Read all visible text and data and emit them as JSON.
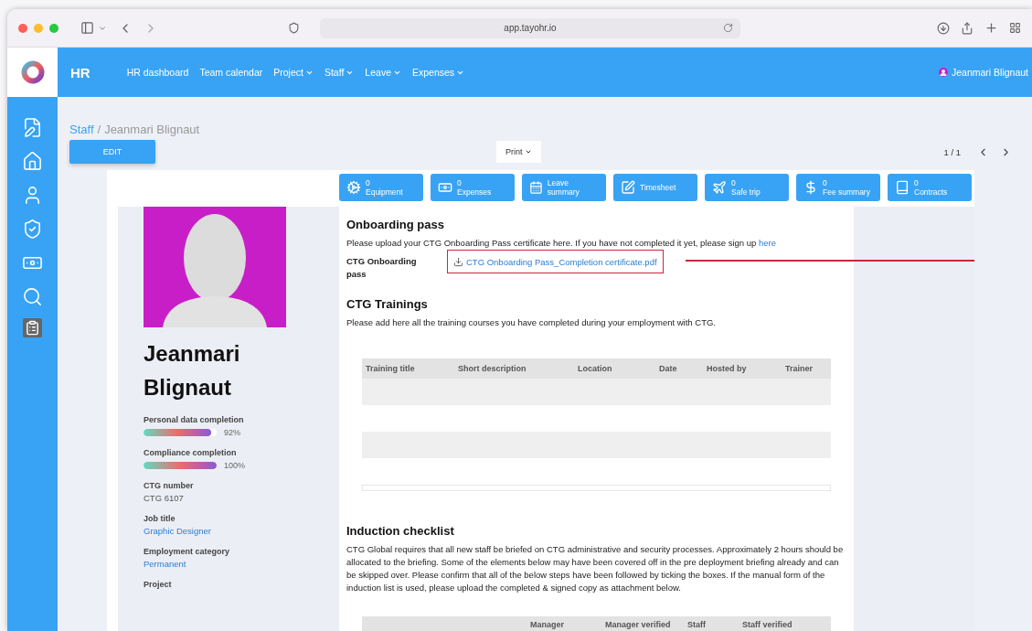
{
  "browser": {
    "url": "app.tayohr.io"
  },
  "header": {
    "title": "HR",
    "nav": [
      {
        "label": "HR dashboard",
        "has_menu": false
      },
      {
        "label": "Team calendar",
        "has_menu": false
      },
      {
        "label": "Project",
        "has_menu": true
      },
      {
        "label": "Staff",
        "has_menu": true
      },
      {
        "label": "Leave",
        "has_menu": true
      },
      {
        "label": "Expenses",
        "has_menu": true
      }
    ],
    "user": "Jeanmari Blignaut"
  },
  "sidebar": {
    "items": [
      {
        "kind": "document"
      },
      {
        "kind": "home"
      },
      {
        "kind": "person"
      },
      {
        "kind": "shield"
      },
      {
        "kind": "money"
      },
      {
        "kind": "search"
      },
      {
        "kind": "report"
      }
    ]
  },
  "breadcrumb": {
    "parent": "Staff",
    "separator": "/",
    "current": "Jeanmari Blignaut"
  },
  "toolbar": {
    "edit": "EDIT",
    "print": "Print",
    "pager": "1 / 1"
  },
  "tiles": [
    {
      "kind": "equipment",
      "count": "0",
      "label": "Equipment"
    },
    {
      "kind": "expenses",
      "count": "0",
      "label": "Expenses"
    },
    {
      "kind": "leave",
      "label": "Leave summary"
    },
    {
      "kind": "timesheet",
      "label": "Timesheet"
    },
    {
      "kind": "trip",
      "count": "0",
      "label": "Safe trip"
    },
    {
      "kind": "fee",
      "count": "0",
      "label": "Fee summary"
    },
    {
      "kind": "contracts",
      "count": "0",
      "label": "Contracts"
    }
  ],
  "profile": {
    "name": "Jeanmari Blignaut",
    "progress": [
      {
        "label": "Personal data completion",
        "level": 0.92,
        "reading": "92%"
      },
      {
        "label": "Compliance completion",
        "level": 1,
        "reading": "100%"
      }
    ],
    "fields": [
      {
        "label": "CTG number",
        "value": "CTG 6107",
        "link": false
      },
      {
        "label": "Job title",
        "value": "Graphic Designer",
        "link": true
      },
      {
        "label": "Employment category",
        "value": "Permanent",
        "link": true
      },
      {
        "label": "Project"
      }
    ]
  },
  "onboarding": {
    "title": "Onboarding pass",
    "text": "Please upload your CTG Onboarding Pass certificate here. If you have not completed it yet, please sign up",
    "link": "here",
    "field_label": "CTG Onboarding pass",
    "file": "CTG Onboarding Pass_Completion certificate.pdf",
    "highlighted": true
  },
  "trainings": {
    "title": "CTG Trainings",
    "text": "Please add here all the training courses you have completed during your employment with CTG.",
    "columns": [
      "Training title",
      "Short description",
      "Location",
      "Date",
      "Hosted by",
      "Trainer"
    ]
  },
  "induction": {
    "title": "Induction checklist",
    "text": "CTG Global requires that all new staff be briefed on CTG administrative and security processes. Approximately 2 hours should be allocated to the briefing. Some of the elements below may have been covered off in the pre deployment briefing already and can be skipped over. Please confirm that all of the below steps have been followed by ticking the boxes. If the manual form of the induction list is used, please upload the completed & signed copy as attachment below.",
    "columns": [
      "Manager",
      "Manager verified",
      "Staff",
      "Staff verified"
    ]
  }
}
